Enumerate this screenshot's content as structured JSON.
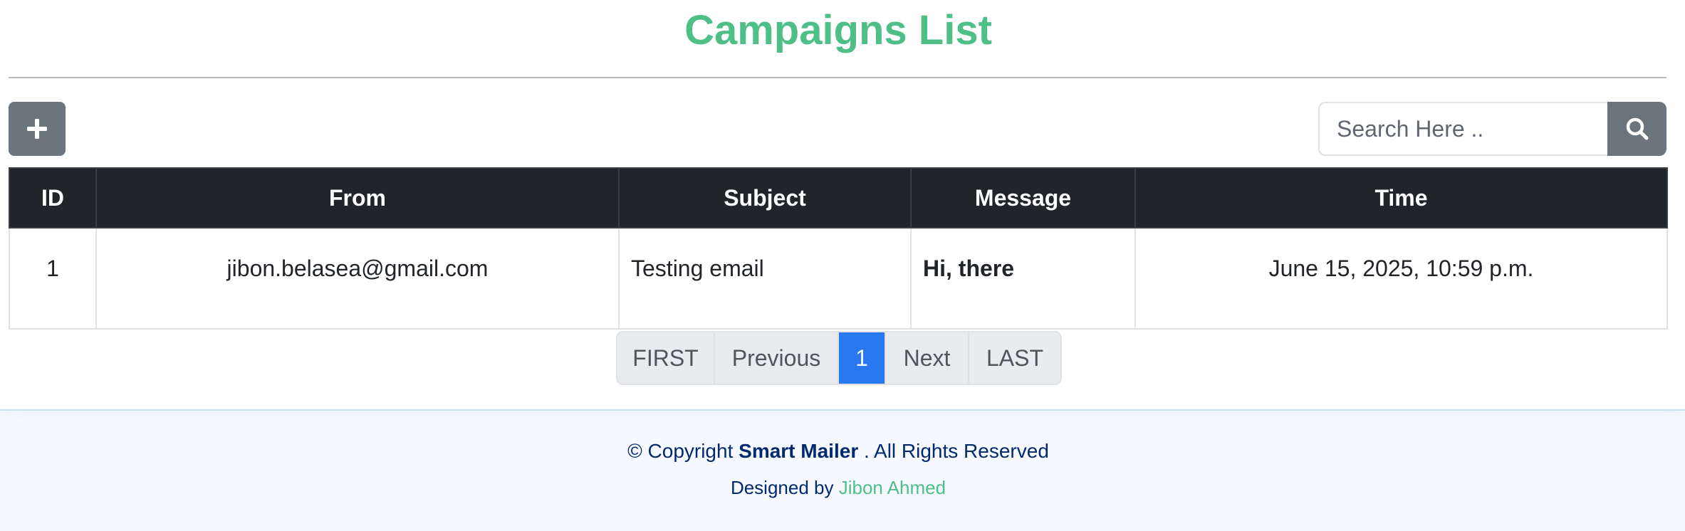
{
  "header": {
    "title": "Campaigns List"
  },
  "toolbar": {
    "add_icon": "plus-icon",
    "search_placeholder": "Search Here ..",
    "search_value": "",
    "search_icon": "search-icon"
  },
  "table": {
    "headers": [
      "ID",
      "From",
      "Subject",
      "Message",
      "Time"
    ],
    "rows": [
      {
        "id": "1",
        "from": "jibon.belasea@gmail.com",
        "subject": "Testing email",
        "message": "Hi, there",
        "time": "June 15, 2025, 10:59 p.m."
      }
    ]
  },
  "pagination": {
    "first": "FIRST",
    "previous": "Previous",
    "current": "1",
    "next": "Next",
    "last": "LAST"
  },
  "footer": {
    "copyright_prefix": "© Copyright",
    "brand": "Smart Mailer",
    "copyright_suffix": ". All Rights Reserved",
    "designed_by": "Designed by",
    "author": "Jibon Ahmed"
  },
  "colors": {
    "accent": "#4fbf88",
    "table_header_bg": "#212529",
    "button_gray": "#6c757d",
    "active_page": "#2a78f0",
    "footer_text": "#012970"
  }
}
